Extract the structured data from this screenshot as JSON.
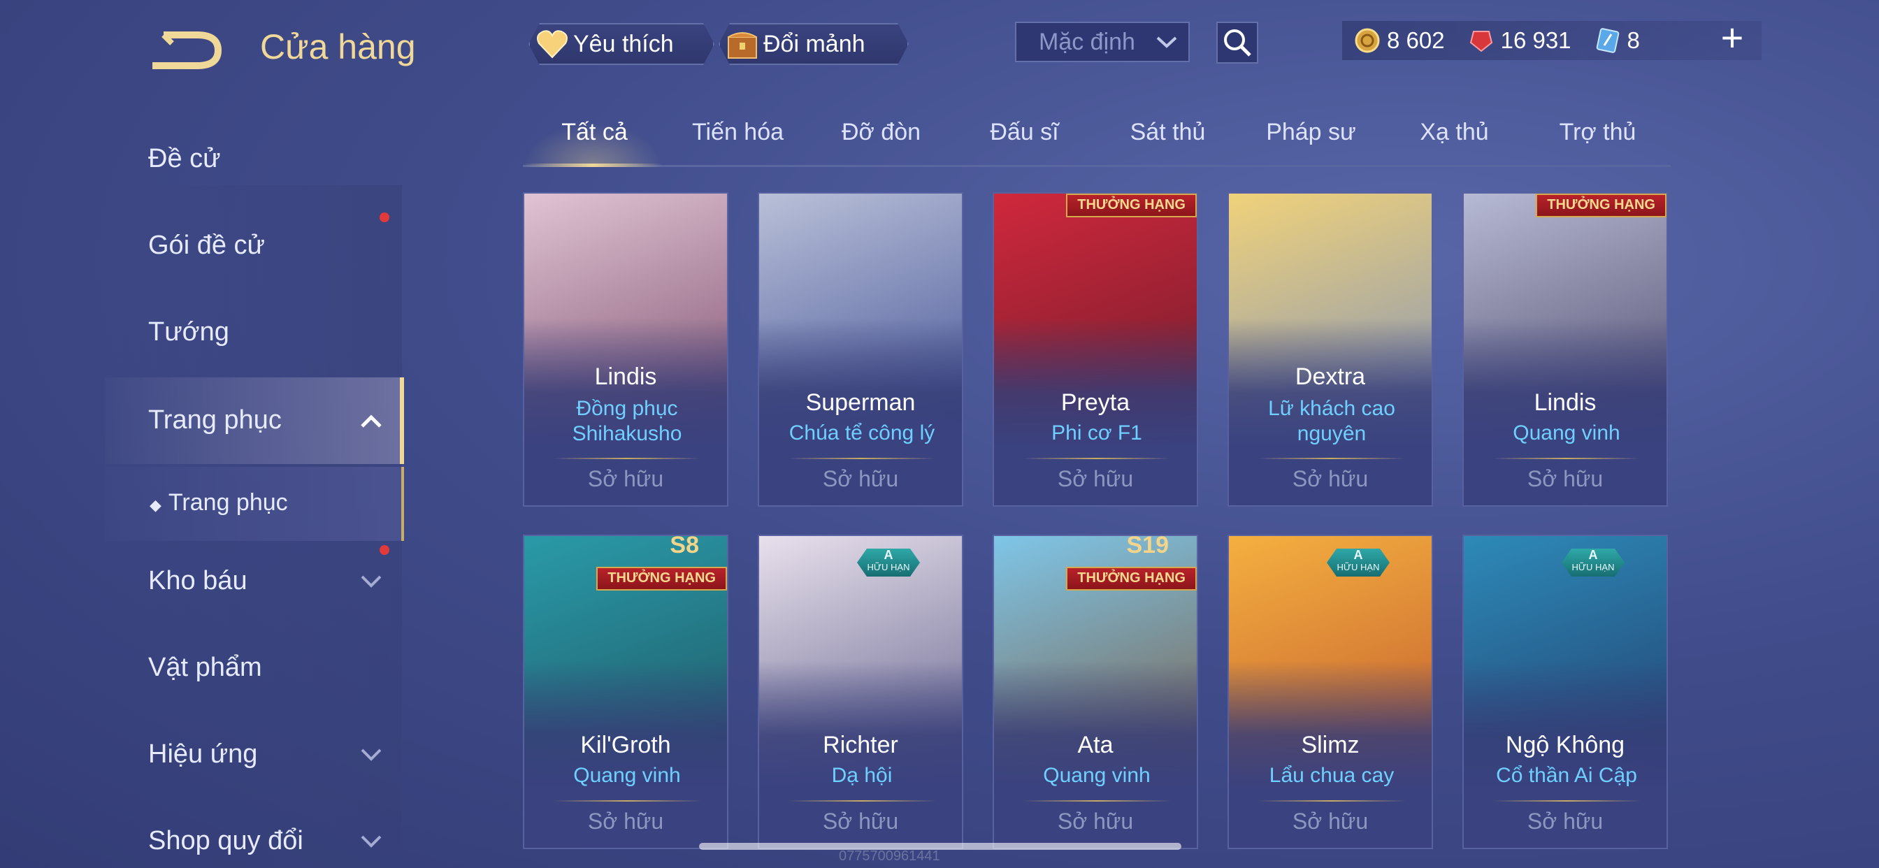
{
  "header": {
    "title": "Cửa hàng",
    "favorite_label": "Yêu thích",
    "fragment_label": "Đổi mảnh",
    "sort_value": "Mặc định"
  },
  "currency": {
    "gold": "8 602",
    "gems": "16 931",
    "vouchers": "8"
  },
  "tabs": [
    "Tất cả",
    "Tiến hóa",
    "Đỡ đòn",
    "Đấu sĩ",
    "Sát thủ",
    "Pháp sư",
    "Xạ thủ",
    "Trợ thủ"
  ],
  "sidebar": {
    "items": [
      "Đề cử",
      "Gói đề cử",
      "Tướng",
      "Trang phục",
      "Kho báu",
      "Vật phẩm",
      "Hiệu ứng",
      "Shop quy đổi"
    ],
    "sub_item": "Trang phục"
  },
  "cards": [
    {
      "name": "Lindis",
      "skin": "Đồng phục Shihakusho",
      "status": "Sở hữu",
      "colors": [
        "#e0c3d4",
        "#6b3a5a"
      ]
    },
    {
      "name": "Superman",
      "skin": "Chúa tể công lý",
      "status": "Sở hữu",
      "colors": [
        "#b9c0d8",
        "#2d3e8a"
      ]
    },
    {
      "name": "Preyta",
      "skin": "Phi cơ F1",
      "status": "Sở hữu",
      "badge": "THƯỞNG HẠNG",
      "colors": [
        "#d0283c",
        "#5a1a28"
      ]
    },
    {
      "name": "Dextra",
      "skin": "Lữ khách cao nguyên",
      "status": "Sở hữu",
      "colors": [
        "#f0d27a",
        "#6d86c4"
      ]
    },
    {
      "name": "Lindis",
      "skin": "Quang vinh",
      "status": "Sở hữu",
      "badge": "THƯỞNG HẠNG",
      "colors": [
        "#b7bad4",
        "#3b3558"
      ]
    },
    {
      "name": "Kil'Groth",
      "skin": "Quang vinh",
      "status": "Sở hữu",
      "badge": "THƯỞNG HẠNG",
      "season": "S8",
      "colors": [
        "#2a9aa8",
        "#1d4a58"
      ]
    },
    {
      "name": "Richter",
      "skin": "Dạ hội",
      "status": "Sở hữu",
      "hbadge_top": "A",
      "hbadge_bottom": "HỮU HẠN",
      "colors": [
        "#e8e0ec",
        "#4a4a7a"
      ]
    },
    {
      "name": "Ata",
      "skin": "Quang vinh",
      "status": "Sở hữu",
      "badge": "THƯỞNG HẠNG",
      "season": "S19",
      "colors": [
        "#7ec6e8",
        "#7a4a2a"
      ]
    },
    {
      "name": "Slimz",
      "skin": "Lẩu chua cay",
      "status": "Sở hữu",
      "hbadge_top": "A",
      "hbadge_bottom": "HỮU HẠN",
      "colors": [
        "#f5b040",
        "#b84a2a"
      ]
    },
    {
      "name": "Ngộ Không",
      "skin": "Cổ thần Ai Cập",
      "status": "Sở hữu",
      "hbadge_top": "A",
      "hbadge_bottom": "HỮU HẠN",
      "colors": [
        "#2d8ab8",
        "#203060"
      ]
    }
  ],
  "icons": {
    "back": "back-arrow-icon",
    "heart": "heart-icon",
    "chest": "chest-icon",
    "search": "search-icon",
    "gold": "gold-coin-icon",
    "gem": "gem-icon",
    "voucher": "voucher-icon",
    "plus": "plus-icon"
  },
  "watermark": "0775700961441"
}
